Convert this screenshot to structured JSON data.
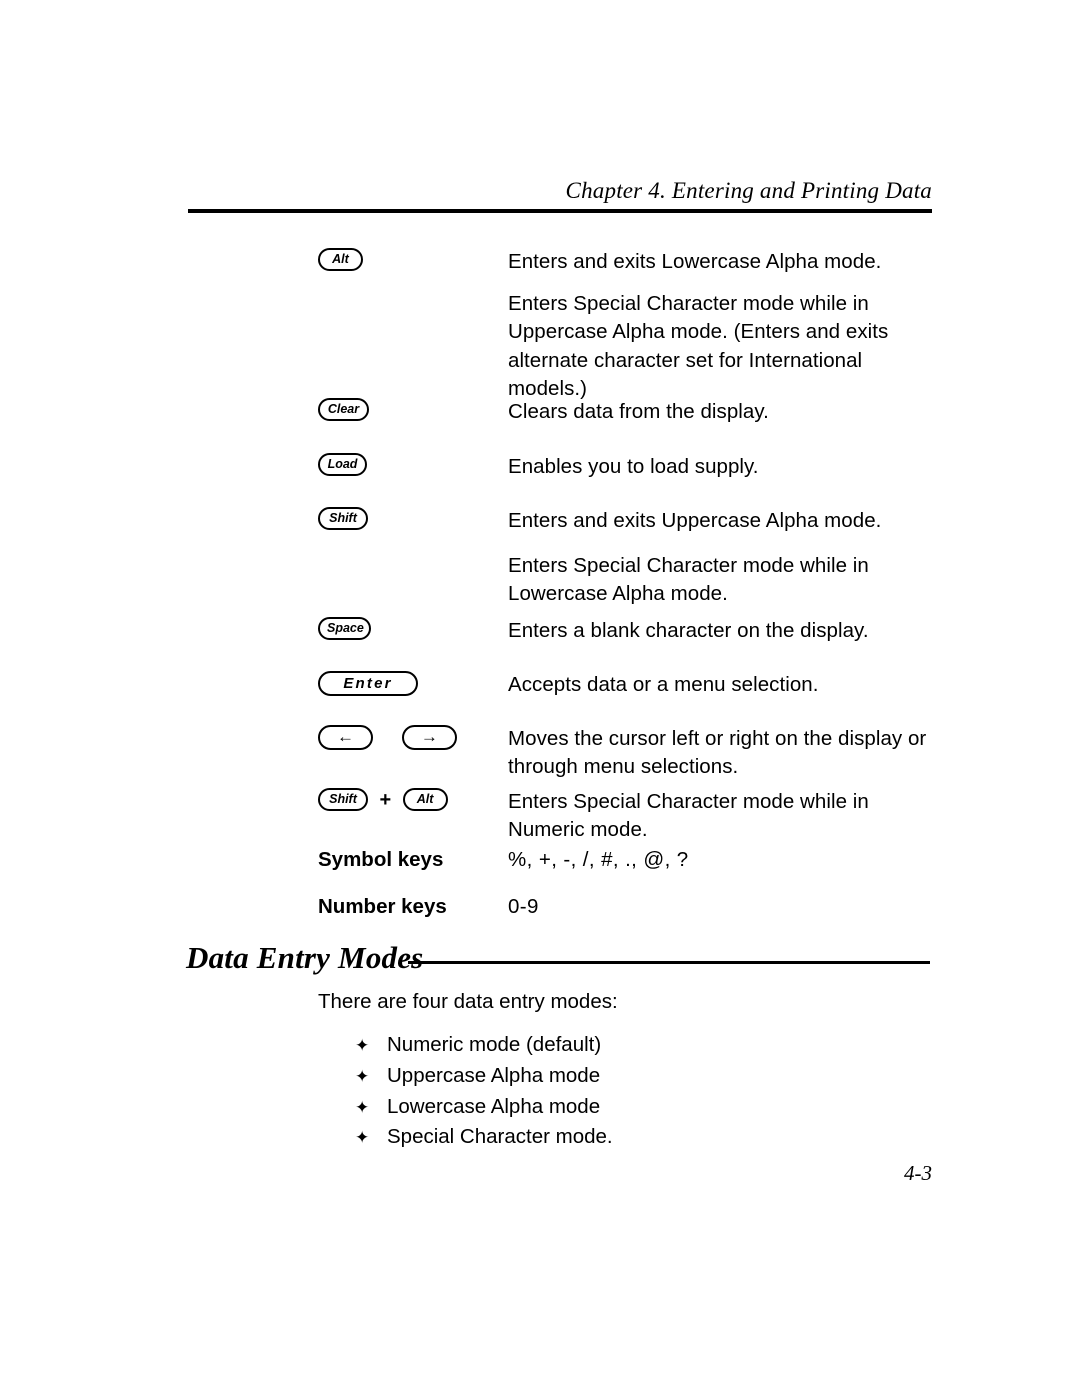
{
  "header": {
    "running_head": "Chapter 4.  Entering and Printing Data"
  },
  "key_rows": [
    {
      "keys": [
        "Alt"
      ],
      "descriptions": [
        "Enters and exits Lowercase Alpha mode.",
        "Enters Special Character mode while in Uppercase Alpha mode.  (Enters and exits alternate  character set for International models.)"
      ]
    },
    {
      "keys": [
        "Clear"
      ],
      "descriptions": [
        "Clears data from the display."
      ]
    },
    {
      "keys": [
        "Load"
      ],
      "descriptions": [
        "Enables you to load supply."
      ]
    },
    {
      "keys": [
        "Shift"
      ],
      "descriptions": [
        "Enters and exits Uppercase Alpha mode.",
        "Enters Special Character mode while in Lowercase Alpha mode."
      ]
    },
    {
      "keys": [
        "Space"
      ],
      "descriptions": [
        "Enters a blank character on the display."
      ]
    },
    {
      "keys": [
        "Enter"
      ],
      "descriptions": [
        "Accepts data or a menu selection."
      ]
    },
    {
      "keys": [
        "←",
        "→"
      ],
      "descriptions": [
        "Moves the cursor left or right on the display or through menu selections."
      ]
    },
    {
      "keys": [
        "Shift",
        "+",
        "Alt"
      ],
      "descriptions": [
        "Enters Special Character mode while in Numeric mode."
      ]
    }
  ],
  "label_rows": [
    {
      "label": "Symbol keys",
      "value": "%, +, -, /, #, ., @, ?"
    },
    {
      "label": "Number keys",
      "value": "0-9"
    }
  ],
  "section": {
    "heading": "Data Entry Modes",
    "intro": "There are four data entry modes:",
    "bullet_glyph": "✦",
    "bullets": [
      "Numeric mode (default)",
      "Uppercase Alpha mode",
      "Lowercase Alpha mode",
      "Special Character mode."
    ]
  },
  "footer": {
    "page_number": "4-3"
  }
}
